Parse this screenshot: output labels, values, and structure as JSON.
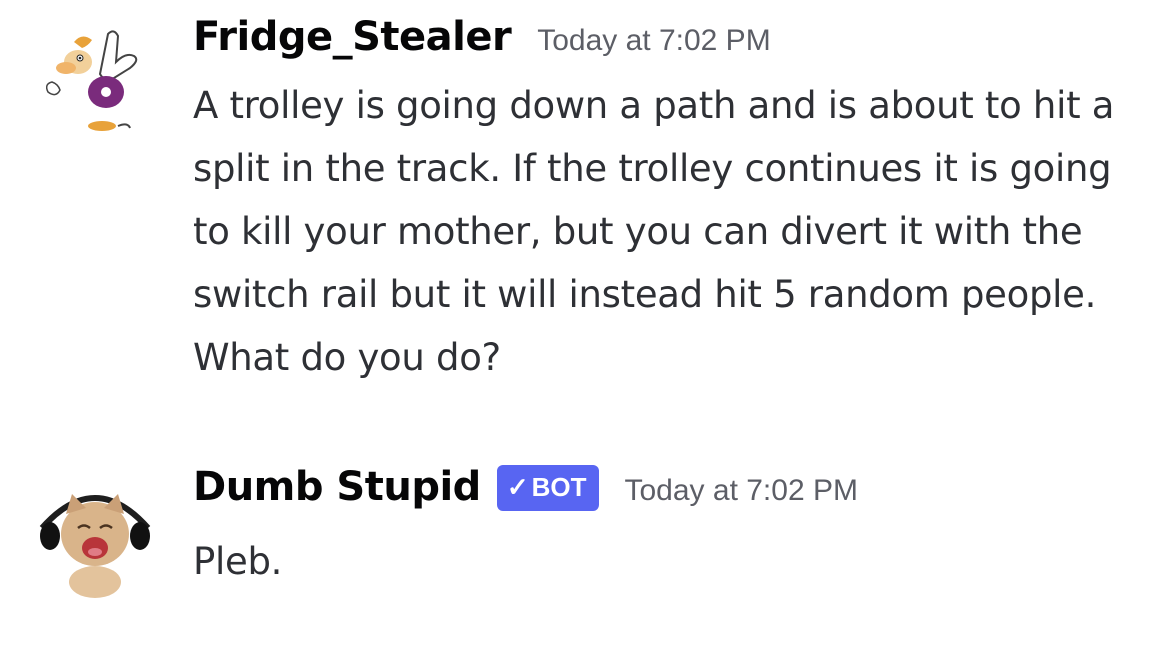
{
  "messages": [
    {
      "author": "Fridge_Stealer",
      "timestamp": "Today at 7:02 PM",
      "content": "A trolley is going down a path and is about to hit a split in the track. If the trolley continues it is going to kill your mother, but you can divert it with the switch rail but it will instead hit 5 random people. What do you do?",
      "avatar_icon": "rayman-avatar-icon",
      "is_bot": false
    },
    {
      "author": "Dumb Stupid",
      "bot_tag": "BOT",
      "bot_check_icon": "checkmark-icon",
      "timestamp": "Today at 7:02 PM",
      "content": "Pleb.",
      "avatar_icon": "cat-headphones-avatar-icon",
      "is_bot": true
    }
  ],
  "colors": {
    "bot_tag_bg": "#5865f2",
    "username": "#060607",
    "timestamp": "#5c5e66",
    "message_text": "#2e3035",
    "background": "#ffffff"
  }
}
